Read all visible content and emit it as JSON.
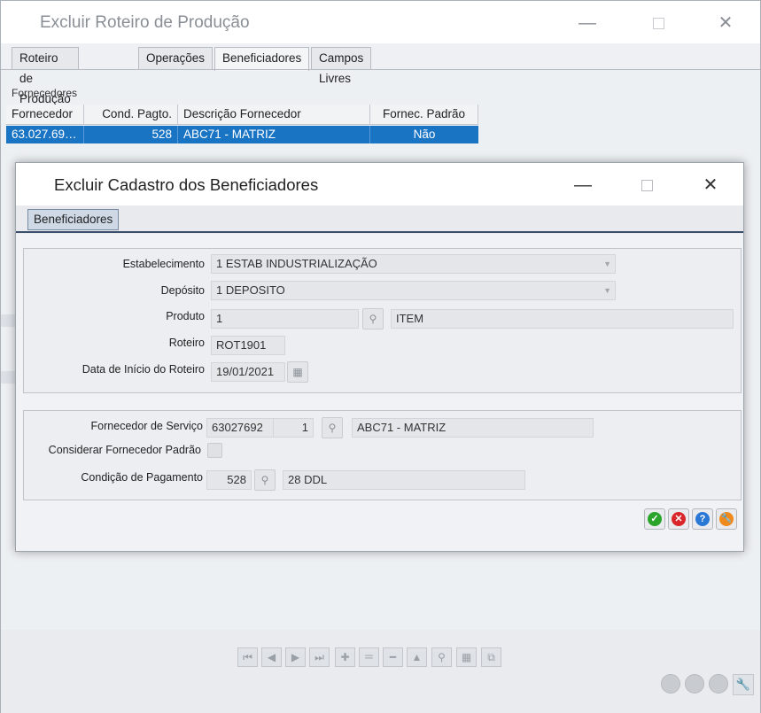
{
  "window": {
    "title": "Excluir Roteiro de Produção",
    "controls": {
      "minimize": "—",
      "maximize": "☐",
      "close": "✕"
    }
  },
  "tabs": [
    {
      "label": "Roteiro de Produção"
    },
    {
      "label": "Operações"
    },
    {
      "label": "Beneficiadores"
    },
    {
      "label": "Campos Livres"
    }
  ],
  "fornecedores": {
    "section_label": "Fornecedores",
    "columns": [
      "Fornecedor",
      "Cond. Pagto.",
      "Descrição Fornecedor",
      "Fornec. Padrão"
    ],
    "rows": [
      {
        "fornecedor": "63.027.69…",
        "cond_pagto": "528",
        "descricao": "ABC71 - MATRIZ",
        "padrao": "Não"
      }
    ]
  },
  "dialog": {
    "title": "Excluir Cadastro dos Beneficiadores",
    "tab": "Beneficiadores",
    "labels": {
      "estabelecimento": "Estabelecimento",
      "deposito": "Depósito",
      "produto": "Produto",
      "roteiro": "Roteiro",
      "data_inicio": "Data de Início do Roteiro",
      "fornecedor_servico": "Fornecedor de Serviço",
      "considerar_padrao": "Considerar Fornecedor Padrão",
      "condicao_pagamento": "Condição de Pagamento"
    },
    "values": {
      "estabelecimento": "1 ESTAB INDUSTRIALIZAÇÃO",
      "deposito": "1 DEPOSITO",
      "produto_codigo": "1",
      "produto_descricao": "ITEM",
      "roteiro": "ROT1901",
      "data_inicio": "19/01/2021",
      "fornecedor_codigo": "63027692",
      "fornecedor_loja": "1",
      "fornecedor_descricao": "ABC71 - MATRIZ",
      "considerar_padrao": false,
      "condicao_codigo": "528",
      "condicao_descricao": "28 DDL"
    },
    "actions": {
      "ok": {
        "icon": "check-icon",
        "color": "#2aa52a",
        "glyph": "✓"
      },
      "cancel": {
        "icon": "x-icon",
        "color": "#d9262b",
        "glyph": "✕"
      },
      "help": {
        "icon": "question-icon",
        "color": "#2a78d6",
        "glyph": "?"
      },
      "tools": {
        "icon": "wrench-icon",
        "color": "#f08a1c",
        "glyph": "🔧"
      }
    }
  },
  "navigation": {
    "glyphs": {
      "first": "⏮",
      "prev": "◀",
      "next": "▶",
      "last": "⏭",
      "add": "✚",
      "edit": "＝",
      "remove": "━",
      "up": "▲",
      "search": "⚲",
      "grid": "▦",
      "export": "⧉"
    }
  },
  "colors": {
    "selection": "#1a74c4",
    "active_tab_border": "#3b4f6b"
  }
}
